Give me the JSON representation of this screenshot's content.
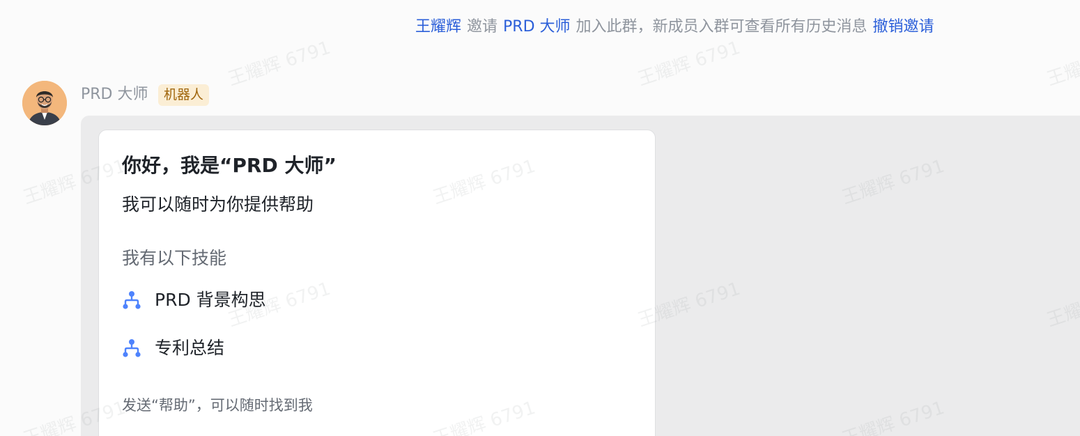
{
  "system_notice": {
    "inviter": "王耀辉",
    "invite_word": "邀请",
    "invitee": "PRD 大师",
    "message": "加入此群，新成员入群可查看所有历史消息",
    "revoke_label": "撤销邀请"
  },
  "message": {
    "sender_name": "PRD 大师",
    "badge": "机器人",
    "avatar_icon": "person-avatar-icon"
  },
  "card": {
    "title": "你好，我是“PRD 大师”",
    "subtitle": "我可以随时为你提供帮助",
    "skills_heading": "我有以下技能",
    "skills": [
      {
        "label": "PRD 背景构思",
        "icon": "org-chart-icon"
      },
      {
        "label": "专利总结",
        "icon": "org-chart-icon"
      }
    ],
    "footer": "发送“帮助”，可以随时找到我"
  },
  "watermark": {
    "text": "王耀辉 6791"
  },
  "colors": {
    "link": "#2b5fd9",
    "badge_bg": "#fbeed5",
    "badge_text": "#a0660d",
    "skill_icon": "#4e83fd"
  }
}
